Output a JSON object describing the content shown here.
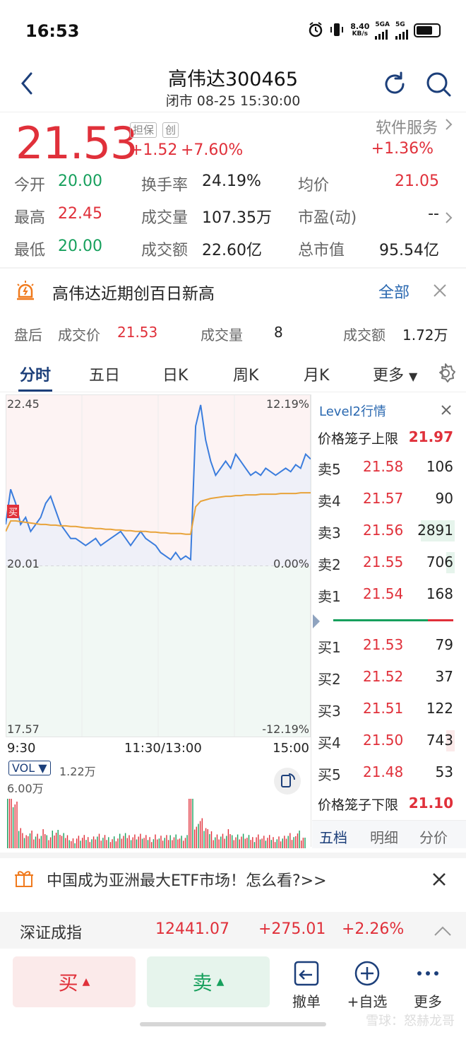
{
  "status_bar": {
    "time": "16:53",
    "net_speed_top": "8.40",
    "net_speed_unit": "KB/s",
    "net_type_1": "5GA",
    "net_type_2": "5G",
    "icons": [
      "alarm-icon",
      "vibrate-icon",
      "signal-icon",
      "battery-icon"
    ]
  },
  "header": {
    "title": "高伟达300465",
    "subtitle": "闭市 08-25 15:30:00",
    "icons": [
      "back-chevron-icon",
      "refresh-icon",
      "search-icon"
    ]
  },
  "quote": {
    "price": "21.53",
    "tags": [
      "担保",
      "创"
    ],
    "change_abs": "+1.52",
    "change_pct": "+7.60%",
    "sector_name": "软件服务",
    "sector_pct": "+1.36%",
    "stats": [
      [
        {
          "label": "今开",
          "value": "20.00",
          "color": "green"
        },
        {
          "label": "换手率",
          "value": "24.19%",
          "color": "black"
        },
        {
          "label": "均价",
          "value": "21.05",
          "color": "red"
        }
      ],
      [
        {
          "label": "最高",
          "value": "22.45",
          "color": "red"
        },
        {
          "label": "成交量",
          "value": "107.35万",
          "color": "black"
        },
        {
          "label": "市盈(动)",
          "value": "--",
          "color": "black"
        }
      ],
      [
        {
          "label": "最低",
          "value": "20.00",
          "color": "green"
        },
        {
          "label": "成交额",
          "value": "22.60亿",
          "color": "black"
        },
        {
          "label": "总市值",
          "value": "95.54亿",
          "color": "black"
        }
      ]
    ]
  },
  "news": {
    "text": "高伟达近期创百日新高",
    "link": "全部"
  },
  "after_hours": {
    "label": "盘后",
    "price_label": "成交价",
    "price": "21.53",
    "volume_label": "成交量",
    "volume": "8",
    "amount_label": "成交额",
    "amount": "1.72万"
  },
  "tabs": [
    "分时",
    "五日",
    "日K",
    "周K",
    "月K",
    "更多"
  ],
  "active_tab": "分时",
  "chart_data": {
    "type": "line",
    "title": "",
    "y_top_left": "22.45",
    "y_mid_left": "20.01",
    "y_bottom_left": "17.57",
    "y_top_right": "12.19%",
    "y_mid_right": "0.00%",
    "y_bottom_right": "-12.19%",
    "x_labels": [
      "9:30",
      "11:30/13:00",
      "15:00"
    ],
    "ylim": [
      17.57,
      22.45
    ],
    "prev_close": 20.01,
    "buy_marker": "买",
    "series": [
      {
        "values": [
          20.6,
          21.1,
          20.9,
          20.6,
          20.7,
          20.5,
          20.6,
          20.7,
          20.9,
          21.0,
          20.8,
          20.6,
          20.5,
          20.4,
          20.4,
          20.35,
          20.3,
          20.35,
          20.4,
          20.3,
          20.35,
          20.4,
          20.45,
          20.5,
          20.4,
          20.3,
          20.4,
          20.5,
          20.4,
          20.35,
          20.3,
          20.2,
          20.15,
          20.1,
          20.2,
          20.1,
          20.15,
          20.1,
          22.0,
          22.3,
          21.8,
          21.5,
          21.3,
          21.4,
          21.5,
          21.4,
          21.6,
          21.5,
          21.4,
          21.3,
          21.35,
          21.3,
          21.4,
          21.35,
          21.3,
          21.35,
          21.4,
          21.35,
          21.45,
          21.4,
          21.6,
          21.53
        ]
      },
      {
        "values": [
          20.5,
          20.65,
          20.65,
          20.64,
          20.63,
          20.62,
          20.61,
          20.6,
          20.6,
          20.59,
          20.59,
          20.58,
          20.58,
          20.57,
          20.57,
          20.56,
          20.55,
          20.55,
          20.54,
          20.54,
          20.53,
          20.53,
          20.52,
          20.52,
          20.51,
          20.51,
          20.5,
          20.5,
          20.5,
          20.49,
          20.49,
          20.48,
          20.48,
          20.47,
          20.47,
          20.47,
          20.46,
          20.46,
          20.85,
          20.93,
          20.95,
          20.97,
          20.98,
          20.99,
          21.0,
          21.0,
          21.01,
          21.01,
          21.02,
          21.02,
          21.02,
          21.03,
          21.03,
          21.03,
          21.03,
          21.04,
          21.04,
          21.04,
          21.04,
          21.05,
          21.05,
          21.05
        ]
      }
    ]
  },
  "volume": {
    "indicator": "VOL",
    "max_label": "1.22万",
    "left_label": "6.00万"
  },
  "order_book": {
    "title": "Level2行情",
    "upper_limit_label": "价格笼子上限",
    "upper_limit": "21.97",
    "asks": [
      {
        "label": "卖5",
        "price": "21.58",
        "vol": "106",
        "bar": 0
      },
      {
        "label": "卖4",
        "price": "21.57",
        "vol": "90",
        "bar": 0
      },
      {
        "label": "卖3",
        "price": "21.56",
        "vol": "2891",
        "bar": 1.0
      },
      {
        "label": "卖2",
        "price": "21.55",
        "vol": "706",
        "bar": 0.24
      },
      {
        "label": "卖1",
        "price": "21.54",
        "vol": "168",
        "bar": 0
      }
    ],
    "bids": [
      {
        "label": "买1",
        "price": "21.53",
        "vol": "79",
        "bar": 0
      },
      {
        "label": "买2",
        "price": "21.52",
        "vol": "37",
        "bar": 0
      },
      {
        "label": "买3",
        "price": "21.51",
        "vol": "122",
        "bar": 0
      },
      {
        "label": "买4",
        "price": "21.50",
        "vol": "743",
        "bar": 0.26
      },
      {
        "label": "买5",
        "price": "21.48",
        "vol": "53",
        "bar": 0
      }
    ],
    "lower_limit_label": "价格笼子下限",
    "lower_limit": "21.10",
    "tabs": [
      "五档",
      "明细",
      "分价"
    ]
  },
  "promo": {
    "text": "中国成为亚洲最大ETF市场！怎么看?>>"
  },
  "index_bar": {
    "name": "深证成指",
    "value": "12441.07",
    "change": "+275.01",
    "pct": "+2.26%"
  },
  "toolbar": {
    "buy": "买",
    "sell": "卖",
    "cancel": "撤单",
    "add_watch": "+自选",
    "more": "更多"
  },
  "watermark": "雪球：怒赫龙哥",
  "colors": {
    "red": "#e0303a",
    "green": "#17a05d",
    "navy": "#1c3f7a",
    "price_line": "#3b7ddd",
    "avg_line": "#e8a33a"
  }
}
